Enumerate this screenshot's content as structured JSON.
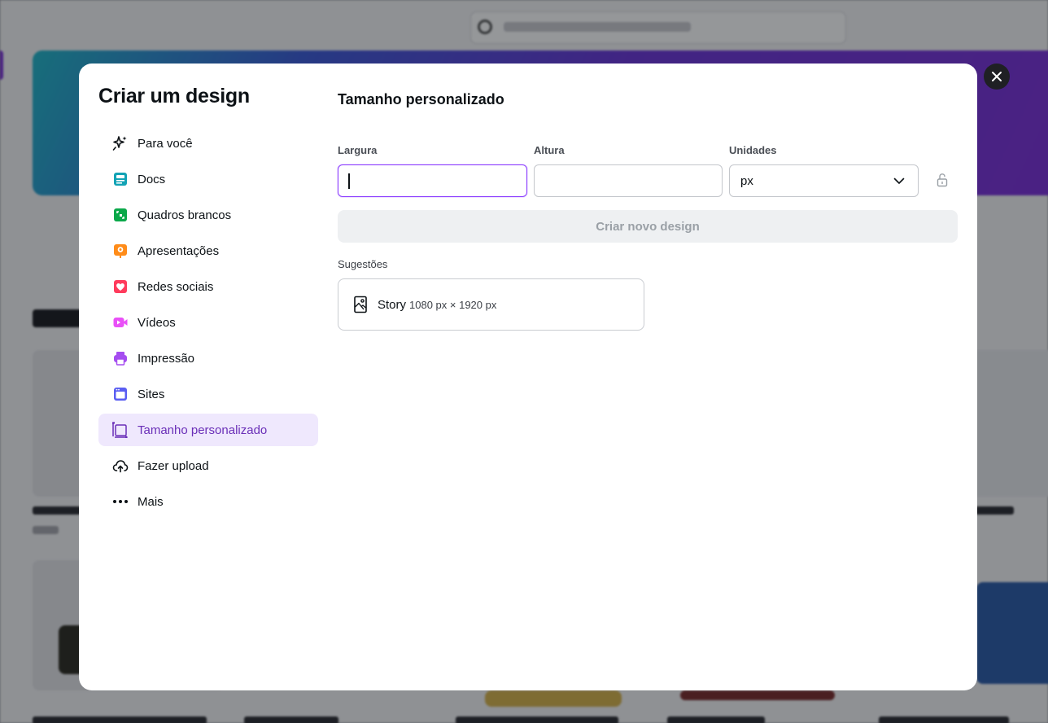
{
  "dialog": {
    "title": "Criar um design",
    "close_icon": "close-icon"
  },
  "nav": {
    "items": [
      {
        "label": "Para você",
        "icon": "sparkle-icon"
      },
      {
        "label": "Docs",
        "icon": "docs-icon",
        "color": "#13a3b5"
      },
      {
        "label": "Quadros brancos",
        "icon": "whiteboard-icon",
        "color": "#0ba84a"
      },
      {
        "label": "Apresentações",
        "icon": "presentation-icon",
        "color": "#ff8c1a"
      },
      {
        "label": "Redes sociais",
        "icon": "heart-icon",
        "color": "#ff3b5c"
      },
      {
        "label": "Vídeos",
        "icon": "video-icon",
        "color": "#e950f7"
      },
      {
        "label": "Impressão",
        "icon": "print-icon",
        "color": "#a54df0"
      },
      {
        "label": "Sites",
        "icon": "website-icon",
        "color": "#5a5ef2"
      },
      {
        "label": "Tamanho personalizado",
        "icon": "resize-icon",
        "active": true,
        "color": "#6a2fb8"
      },
      {
        "label": "Fazer upload",
        "icon": "cloud-upload-icon"
      },
      {
        "label": "Mais",
        "icon": "more-dots-icon"
      }
    ]
  },
  "custom_size": {
    "title": "Tamanho personalizado",
    "width_label": "Largura",
    "width_value": "",
    "height_label": "Altura",
    "height_value": "",
    "units_label": "Unidades",
    "units_value": "px",
    "lock_icon": "unlock-icon",
    "create_button": "Criar novo design",
    "suggestions_label": "Sugestões",
    "suggestions": [
      {
        "name": "Story",
        "dims": "1080 px × 1920 px",
        "icon": "portrait-image-icon"
      }
    ]
  },
  "colors": {
    "accent": "#8b3dff",
    "active_bg": "#efe8fd",
    "active_text": "#6a2fb8"
  }
}
